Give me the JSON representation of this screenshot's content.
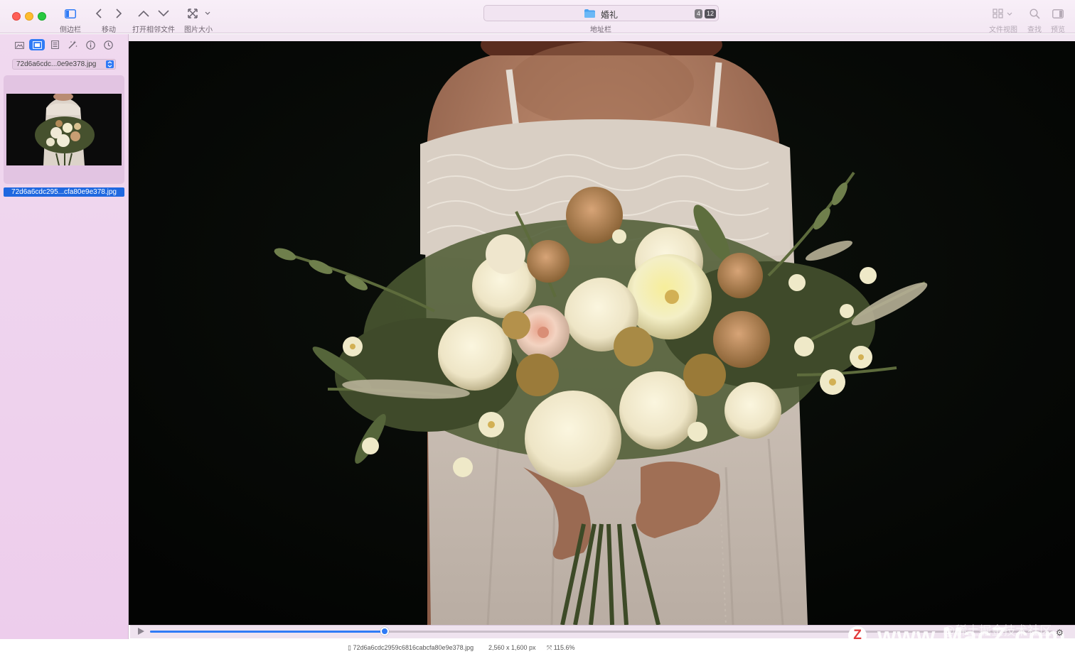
{
  "toolbar": {
    "sidebar_label": "侧边栏",
    "move_label": "移动",
    "open_adjacent_label": "打开相邻文件",
    "image_size_label": "图片大小",
    "address_bar_label": "地址栏",
    "file_view_label": "文件视图",
    "find_label": "查找",
    "preview_label": "预览"
  },
  "address": {
    "folder_title": "婚礼",
    "badge_small": "4",
    "badge_count": "12"
  },
  "sidebar": {
    "file_selector": "72d6a6cdc...0e9e378.jpg",
    "thumbnail_name": "72d6a6cdc295...cfa80e9e378.jpg"
  },
  "viewer": {
    "progress_fraction": 0.26
  },
  "status": {
    "filename": "72d6a6cdc2959c6816cabcfa80e9e378.jpg",
    "dimensions": "2,560 x 1,600 px",
    "zoom": "115.6%"
  },
  "watermarks": {
    "juejin": "@稀土掘金技术社区",
    "macz": "www.MacZ.com",
    "logo_letter": "Z"
  },
  "colors": {
    "accent": "#2f7bf6",
    "sidebar_bg": "#edcdec",
    "toolbar_bg": "#f5ebf5",
    "photo_bg": "#050605"
  }
}
